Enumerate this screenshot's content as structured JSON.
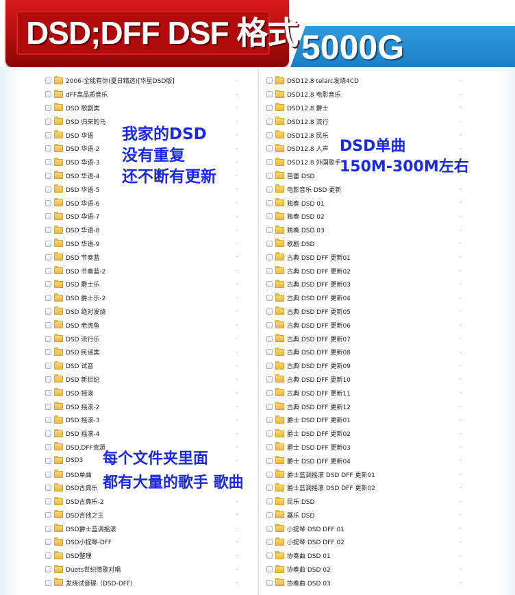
{
  "banner": {
    "title": "DSD;DFF DSF 格式",
    "size": "5000G"
  },
  "icons": {
    "checkbox": "checkbox-icon",
    "folder": "folder-icon"
  },
  "colors": {
    "banner_red": "#b10b0b",
    "banner_blue": "#1d7fc4",
    "annotation_text": "#1a29e6",
    "folder": "#e8b53a"
  },
  "left_list": [
    {
      "name": "2006-全能有你(夏日精选)[华星DSD版]",
      "value": "-"
    },
    {
      "name": "dFF高品质音乐",
      "value": "-"
    },
    {
      "name": "DSD 歌剧类",
      "value": "-"
    },
    {
      "name": "DSD 归来的马",
      "value": "-"
    },
    {
      "name": "DSD 华语",
      "value": "-"
    },
    {
      "name": "DSD 华语-2",
      "value": "-"
    },
    {
      "name": "DSD 华语-3",
      "value": "-"
    },
    {
      "name": "DSD 华语-4",
      "value": "-"
    },
    {
      "name": "DSD 华语-5",
      "value": "-"
    },
    {
      "name": "DSD 华语-6",
      "value": "-"
    },
    {
      "name": "DSD 华语-7",
      "value": "-"
    },
    {
      "name": "DSD 华语-8",
      "value": "-"
    },
    {
      "name": "DSD 华语-9",
      "value": "-"
    },
    {
      "name": "DSD 节奏蓝",
      "value": "-"
    },
    {
      "name": "DSD 节奏蓝-2",
      "value": "-"
    },
    {
      "name": "DSD 爵士乐",
      "value": "-"
    },
    {
      "name": "DSD 爵士乐-2",
      "value": "-"
    },
    {
      "name": "DSD 绝对发烧",
      "value": "-"
    },
    {
      "name": "DSD 老虎鱼",
      "value": "-"
    },
    {
      "name": "DSD 流行乐",
      "value": "-"
    },
    {
      "name": "DSD 民谣类",
      "value": "-"
    },
    {
      "name": "DSD 试音",
      "value": "-"
    },
    {
      "name": "DSD 新世纪",
      "value": "-"
    },
    {
      "name": "DSD 摇滚",
      "value": "-"
    },
    {
      "name": "DSD 摇滚-2",
      "value": "-"
    },
    {
      "name": "DSD 摇滚-3",
      "value": "-"
    },
    {
      "name": "DSD 摇滚-4",
      "value": "-"
    },
    {
      "name": "DSD,DFF资源",
      "value": "-"
    },
    {
      "name": "DSD3",
      "value": "-"
    },
    {
      "name": "DSD单曲",
      "value": "-"
    },
    {
      "name": "DSD古典乐",
      "value": "-"
    },
    {
      "name": "DSD古典乐-2",
      "value": "-"
    },
    {
      "name": "DSD吉他之王",
      "value": "-"
    },
    {
      "name": "DSD爵士蓝调摇滚",
      "value": "-"
    },
    {
      "name": "DSD小提琴-DFF",
      "value": "-"
    },
    {
      "name": "DSD整理",
      "value": "-"
    },
    {
      "name": "Duets世纪情歌对唱",
      "value": "-"
    },
    {
      "name": "发烧试音碟（DSD-DFF）",
      "value": "-"
    }
  ],
  "right_list": [
    {
      "name": "DSD12.8 telarc发烧4CD",
      "value": "-"
    },
    {
      "name": "DSD12.8 电影音乐",
      "value": "-"
    },
    {
      "name": "DSD12.8 爵士",
      "value": "-"
    },
    {
      "name": "DSD12.8 流行",
      "value": "-"
    },
    {
      "name": "DSD12.8 民乐",
      "value": "-"
    },
    {
      "name": "DSD12.8 人声",
      "value": "-"
    },
    {
      "name": "DSD12.8 外国歌手",
      "value": "-"
    },
    {
      "name": "芭蕾 DSD",
      "value": "-"
    },
    {
      "name": "电影音乐 DSD 更新",
      "value": "-"
    },
    {
      "name": "独奏 DSD 01",
      "value": "-"
    },
    {
      "name": "独奏 DSD 02",
      "value": "-"
    },
    {
      "name": "独奏 DSD 03",
      "value": "-"
    },
    {
      "name": "歌剧 DSD",
      "value": "-"
    },
    {
      "name": "古典 DSD DFF 更新01",
      "value": "-"
    },
    {
      "name": "古典 DSD DFF 更新02",
      "value": "-"
    },
    {
      "name": "古典 DSD DFF 更新03",
      "value": "-"
    },
    {
      "name": "古典 DSD DFF 更新04",
      "value": "-"
    },
    {
      "name": "古典 DSD DFF 更新05",
      "value": "-"
    },
    {
      "name": "古典 DSD DFF 更新06",
      "value": "-"
    },
    {
      "name": "古典 DSD DFF 更新07",
      "value": "-"
    },
    {
      "name": "古典 DSD DFF 更新08",
      "value": "-"
    },
    {
      "name": "古典 DSD DFF 更新09",
      "value": "-"
    },
    {
      "name": "古典 DSD DFF 更新10",
      "value": "-"
    },
    {
      "name": "古典 DSD DFF 更新11",
      "value": "-"
    },
    {
      "name": "古典 DSD DFF 更新12",
      "value": "-"
    },
    {
      "name": "爵士 DSD DFF 更新01",
      "value": "-"
    },
    {
      "name": "爵士 DSD DFF 更新02",
      "value": "-"
    },
    {
      "name": "爵士 DSD DFF 更新03",
      "value": "-"
    },
    {
      "name": "爵士 DSD DFF 更新04",
      "value": "-"
    },
    {
      "name": "爵士蓝调摇滚 DSD DFF 更新01",
      "value": "-"
    },
    {
      "name": "爵士蓝调摇滚 DSD DFF 更新02",
      "value": "-"
    },
    {
      "name": "民乐 DSD",
      "value": "-"
    },
    {
      "name": "器乐 DSD",
      "value": "-"
    },
    {
      "name": "小提琴 DSD DFF 01",
      "value": "-"
    },
    {
      "name": "小提琴 DSD DFF 02",
      "value": "-"
    },
    {
      "name": "协奏曲 DSD 01",
      "value": "-"
    },
    {
      "name": "协奏曲 DSD 02",
      "value": "-"
    },
    {
      "name": "协奏曲 DSD 03",
      "value": "-"
    }
  ],
  "annotations": {
    "note1": [
      "我家的DSD",
      "没有重复",
      "还不断有更新"
    ],
    "note2": [
      "DSD单曲",
      "150M-300M左右"
    ],
    "note3": [
      "每个文件夹里面",
      "都有大量的歌手 歌曲"
    ]
  }
}
